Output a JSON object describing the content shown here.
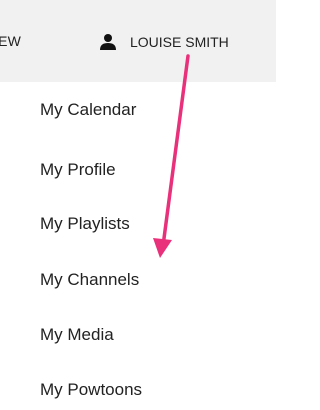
{
  "header": {
    "nav_partial": "IEW",
    "user_icon": "user-icon",
    "user_name": "LOUISE SMITH"
  },
  "dropdown": {
    "items": [
      {
        "label": "My Calendar"
      },
      {
        "label": "My Profile"
      },
      {
        "label": "My Playlists"
      },
      {
        "label": "My Channels"
      },
      {
        "label": "My Media"
      },
      {
        "label": "My Powtoons"
      }
    ]
  },
  "annotation": {
    "arrow_color": "#e8317a"
  },
  "colors": {
    "header_background": "#f1f1f1",
    "text": "#222222"
  }
}
